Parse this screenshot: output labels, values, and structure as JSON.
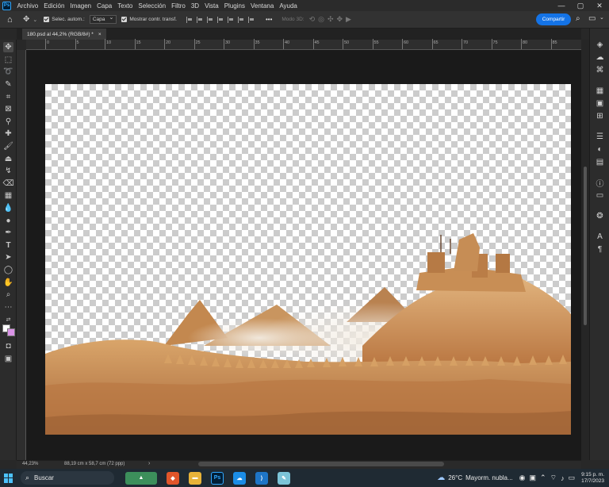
{
  "menu": {
    "items": [
      "Archivo",
      "Edición",
      "Imagen",
      "Capa",
      "Texto",
      "Selección",
      "Filtro",
      "3D",
      "Vista",
      "Plugins",
      "Ventana",
      "Ayuda"
    ],
    "logo": "Ps"
  },
  "window_controls": {
    "minimize": "—",
    "maximize": "▢",
    "close": "✕"
  },
  "options": {
    "auto_select_label": "Selec. autom.:",
    "layer_select": "Capa",
    "show_transform_label": "Mostrar contr. transf.",
    "mode_3d": "Modo 3D:",
    "more": "•••",
    "share_button": "Compartir"
  },
  "document": {
    "tab_title": "180.psd al 44,2% (RGB/8#) *",
    "close": "×"
  },
  "ruler": {
    "h_labels": [
      "0",
      "5",
      "10",
      "15",
      "20",
      "25",
      "30",
      "35",
      "40",
      "45",
      "50",
      "55",
      "60",
      "65",
      "70",
      "75",
      "80",
      "85"
    ]
  },
  "status": {
    "zoom": "44,23%",
    "doc_size": "88,19 cm x 58,7 cm (72 ppp)",
    "arrow": "›"
  },
  "taskbar": {
    "search_placeholder": "Buscar",
    "weather_temp": "26°C",
    "weather_text": "Mayorm. nubla...",
    "time": "9:15 p. m.",
    "date": "17/7/2023",
    "ps_label": "Ps"
  },
  "colors": {
    "accent": "#1473e6",
    "foreground": "#ffffff",
    "background": "#d993e6",
    "taskbar": "#1f2a33"
  }
}
